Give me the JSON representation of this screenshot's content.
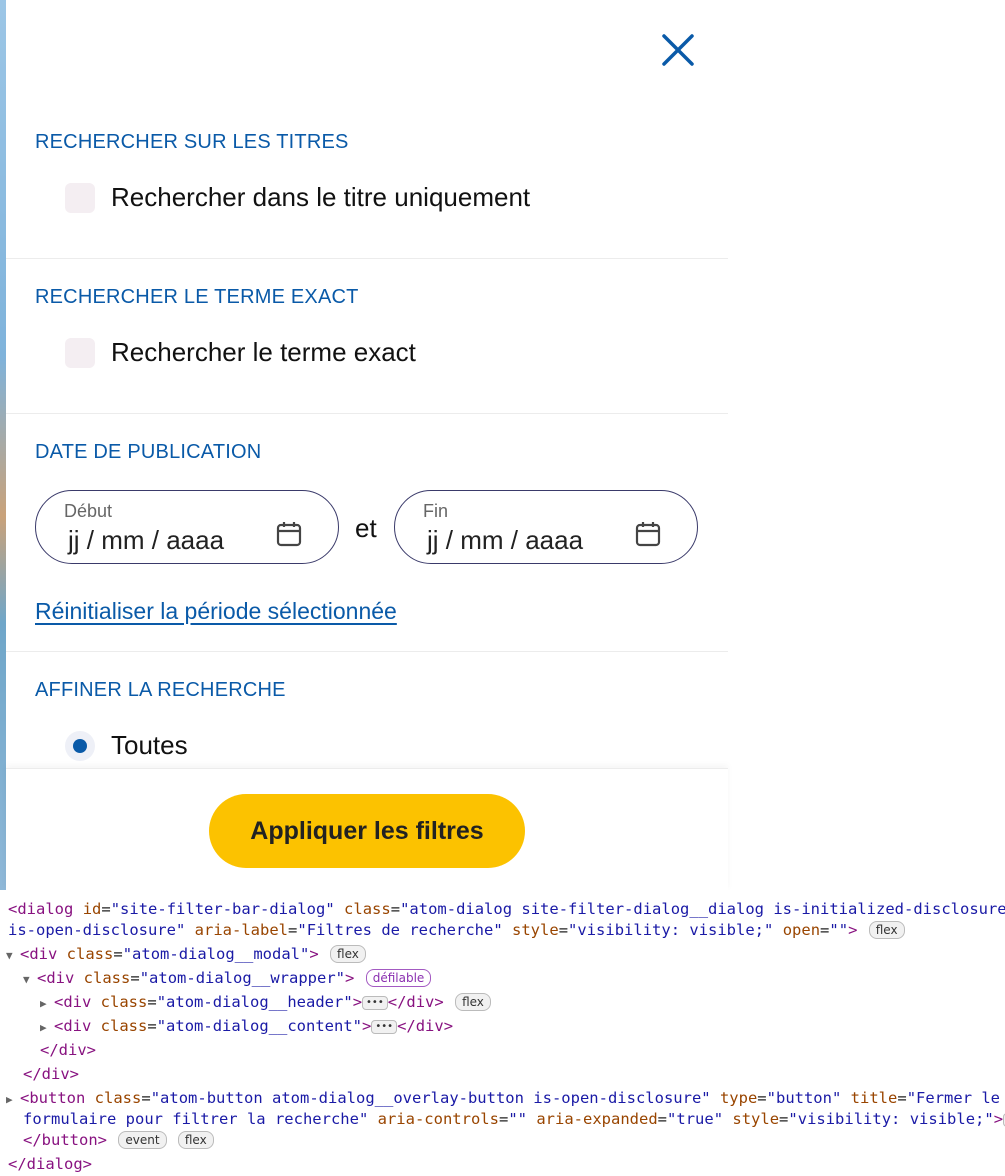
{
  "dialog": {
    "close_icon": "close-x-icon",
    "sections": [
      {
        "title": "RECHERCHER SUR LES TITRES",
        "checkbox_label": "Rechercher dans le titre uniquement",
        "checked": false
      },
      {
        "title": "RECHERCHER LE TERME EXACT",
        "checkbox_label": "Rechercher le terme exact",
        "checked": false
      }
    ],
    "date": {
      "title": "DATE DE PUBLICATION",
      "start_label": "Début",
      "start_value": "jj / mm / aaaa",
      "separator": "et",
      "end_label": "Fin",
      "end_value": "jj / mm / aaaa",
      "calendar_icon": "calendar-icon",
      "reset_link": "Réinitialiser la période sélectionnée"
    },
    "refine": {
      "title": "AFFINER LA RECHERCHE",
      "options": [
        {
          "label": "Toutes",
          "selected": true
        }
      ]
    },
    "apply_label": "Appliquer les filtres",
    "accent_color": "#0a5aa8",
    "button_color": "#fcc200"
  },
  "devtools": {
    "l1_tag": "dialog",
    "l1_id": "site-filter-bar-dialog",
    "l1_class": "atom-dialog site-filter-dialog__dialog is-initialized-disclosure",
    "l2_class_cont": "is-open-disclosure",
    "l2_aria_label": "Filtres de recherche",
    "l2_style": "visibility: visible;",
    "l2_open": "",
    "badge_flex": "flex",
    "modal_class": "atom-dialog__modal",
    "wrapper_class": "atom-dialog__wrapper",
    "badge_scroll": "défilable",
    "header_class": "atom-dialog__header",
    "content_class": "atom-dialog__content",
    "button_class": "atom-button atom-dialog__overlay-button is-open-disclosure",
    "button_type": "button",
    "button_title_1": "Fermer le",
    "button_title_2": "formulaire pour filtrer la recherche",
    "button_aria_controls": "",
    "button_aria_expanded": "true",
    "button_style": "visibility: visible;",
    "badge_event": "event"
  }
}
